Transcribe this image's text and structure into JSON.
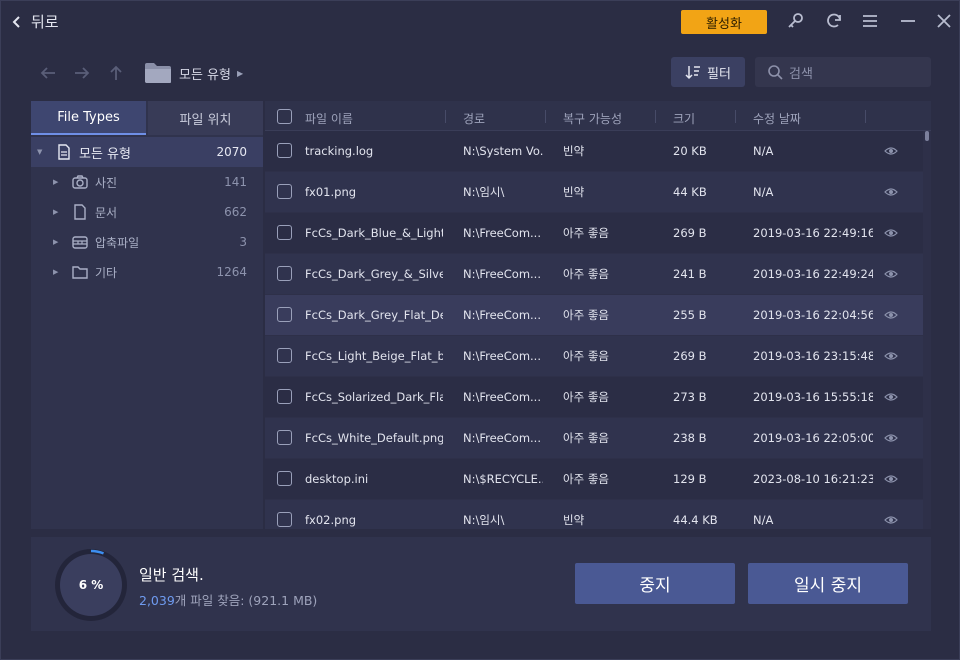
{
  "titlebar": {
    "back_label": "뒤로",
    "activate_label": "활성화",
    "accent_color": "#f2a415"
  },
  "nav": {
    "breadcrumb": "모든 유형",
    "filter_label": "필터",
    "search_placeholder": "검색"
  },
  "left_panel": {
    "tabs": [
      {
        "label": "File Types",
        "active": true
      },
      {
        "label": "파일 위치",
        "active": false
      }
    ],
    "tree": {
      "root": {
        "label": "모든 유형",
        "count": "2070",
        "icon": "document-icon"
      },
      "children": [
        {
          "label": "사진",
          "count": "141",
          "icon": "camera-icon"
        },
        {
          "label": "문서",
          "count": "662",
          "icon": "document-icon"
        },
        {
          "label": "압축파일",
          "count": "3",
          "icon": "archive-icon"
        },
        {
          "label": "기타",
          "count": "1264",
          "icon": "folder-icon"
        }
      ]
    }
  },
  "table": {
    "headers": {
      "name": "파일 이름",
      "path": "경로",
      "recoverability": "복구 가능성",
      "size": "크기",
      "modified": "수정 날짜"
    },
    "rows": [
      {
        "name": "tracking.log",
        "path": "N:\\System Vo...",
        "recov": "빈약",
        "size": "20 KB",
        "date": "N/A"
      },
      {
        "name": "fx01.png",
        "path": "N:\\임시\\",
        "recov": "빈약",
        "size": "44 KB",
        "date": "N/A"
      },
      {
        "name": "FcCs_Dark_Blue_&_Light...",
        "path": "N:\\FreeCom...",
        "recov": "아주 좋음",
        "size": "269 B",
        "date": "2019-03-16 22:49:16"
      },
      {
        "name": "FcCs_Dark_Grey_&_Silve...",
        "path": "N:\\FreeCom...",
        "recov": "아주 좋음",
        "size": "241 B",
        "date": "2019-03-16 22:49:24"
      },
      {
        "name": "FcCs_Dark_Grey_Flat_De...",
        "path": "N:\\FreeCom...",
        "recov": "아주 좋음",
        "size": "255 B",
        "date": "2019-03-16 22:04:56"
      },
      {
        "name": "FcCs_Light_Beige_Flat_b...",
        "path": "N:\\FreeCom...",
        "recov": "아주 좋음",
        "size": "269 B",
        "date": "2019-03-16 23:15:48"
      },
      {
        "name": "FcCs_Solarized_Dark_Fla...",
        "path": "N:\\FreeCom...",
        "recov": "아주 좋음",
        "size": "273 B",
        "date": "2019-03-16 15:55:18"
      },
      {
        "name": "FcCs_White_Default.png",
        "path": "N:\\FreeCom...",
        "recov": "아주 좋음",
        "size": "238 B",
        "date": "2019-03-16 22:05:00"
      },
      {
        "name": "desktop.ini",
        "path": "N:\\$RECYCLE....",
        "recov": "아주 좋음",
        "size": "129 B",
        "date": "2023-08-10 16:21:23"
      },
      {
        "name": "fx02.png",
        "path": "N:\\임시\\",
        "recov": "빈약",
        "size": "44.4 KB",
        "date": "N/A"
      }
    ]
  },
  "status": {
    "percent_label": "6 %",
    "progress": 0.06,
    "title": "일반 검색.",
    "found_count": "2,039",
    "found_suffix": "개 파일 찾음: (921.1 MB)",
    "stop_label": "중지",
    "pause_label": "일시 중지"
  }
}
